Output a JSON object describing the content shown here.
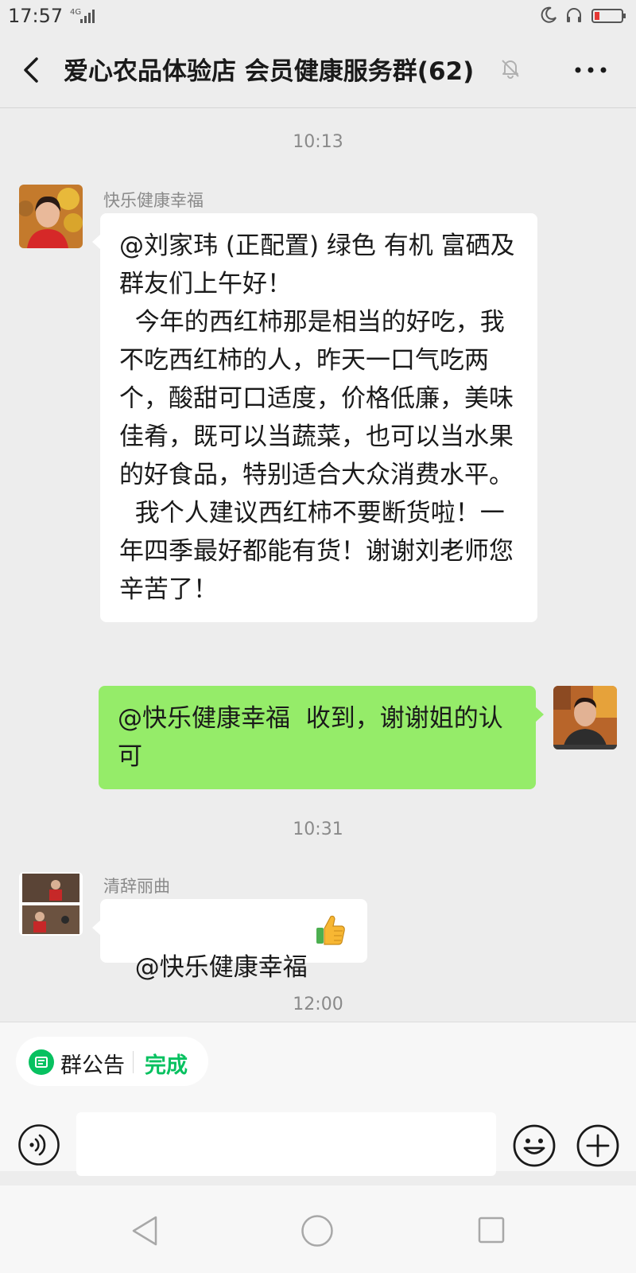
{
  "status_bar": {
    "time": "17:57",
    "network": "4G",
    "battery_color": "#e53935"
  },
  "header": {
    "title": "爱心农品体验店 会员健康服务群(62)"
  },
  "messages": [
    {
      "type": "timestamp",
      "text": "10:13"
    },
    {
      "type": "incoming",
      "sender": "快乐健康幸福",
      "text": "@刘家玮 (正配置) 绿色 有机 富硒及群友们上午好！\n  今年的西红柿那是相当的好吃，我不吃西红柿的人，昨天一口气吃两个，酸甜可口适度，价格低廉，美味佳肴，既可以当蔬菜，也可以当水果的好食品，特别适合大众消费水平。\n  我个人建议西红柿不要断货啦！一年四季最好都能有货！谢谢刘老师您辛苦了！"
    },
    {
      "type": "outgoing",
      "text": "@快乐健康幸福  收到，谢谢姐的认可"
    },
    {
      "type": "timestamp",
      "text": "10:31"
    },
    {
      "type": "incoming",
      "sender": "清辞丽曲",
      "text": "@快乐健康幸福 ",
      "emoji": "thumbs-up"
    },
    {
      "type": "timestamp",
      "text": "12:00"
    }
  ],
  "notice": {
    "label": "群公告",
    "done": "完成"
  },
  "input": {
    "value": "",
    "placeholder": ""
  },
  "colors": {
    "background": "#ededed",
    "outgoing_bubble": "#95ec69",
    "incoming_bubble": "#ffffff",
    "accent_green": "#07c160"
  }
}
